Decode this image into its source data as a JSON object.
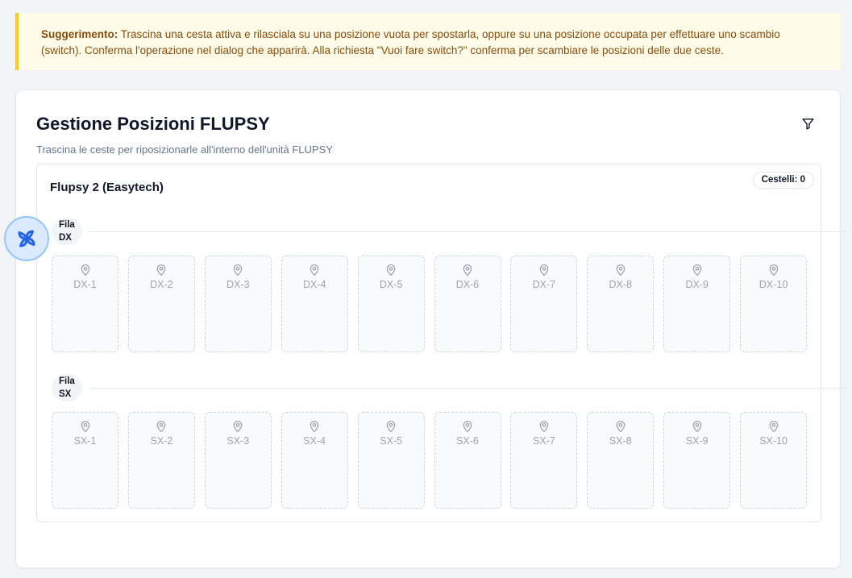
{
  "tip": {
    "label": "Suggerimento:",
    "text": " Trascina una cesta attiva e rilasciala su una posizione vuota per spostarla, oppure su una posizione occupata per effettuare uno scambio (switch). Conferma l'operazione nel dialog che apparirà. Alla richiesta \"Vuoi fare switch?\" conferma per scambiare le posizioni delle due ceste."
  },
  "header": {
    "title": "Gestione Posizioni FLUPSY",
    "subtitle": "Trascina le ceste per riposizionarle all'interno dell'unità FLUPSY",
    "filter_icon": "filter-icon"
  },
  "unit": {
    "name": "Flupsy 2 (Easytech)",
    "badge": "Cestelli: 0"
  },
  "rows": [
    {
      "label_line1": "Fila",
      "label_line2": "DX",
      "slots": [
        "DX-1",
        "DX-2",
        "DX-3",
        "DX-4",
        "DX-5",
        "DX-6",
        "DX-7",
        "DX-8",
        "DX-9",
        "DX-10"
      ]
    },
    {
      "label_line1": "Fila",
      "label_line2": "SX",
      "slots": [
        "SX-1",
        "SX-2",
        "SX-3",
        "SX-4",
        "SX-5",
        "SX-6",
        "SX-7",
        "SX-8",
        "SX-9",
        "SX-10"
      ]
    }
  ],
  "slot_icon": "map-pin-icon",
  "fab_icon": "pinwheel-icon",
  "colors": {
    "tip_background": "#fefce8",
    "tip_border": "#facc15",
    "tip_text": "#854d0e",
    "fab_blue": "#2563eb"
  }
}
